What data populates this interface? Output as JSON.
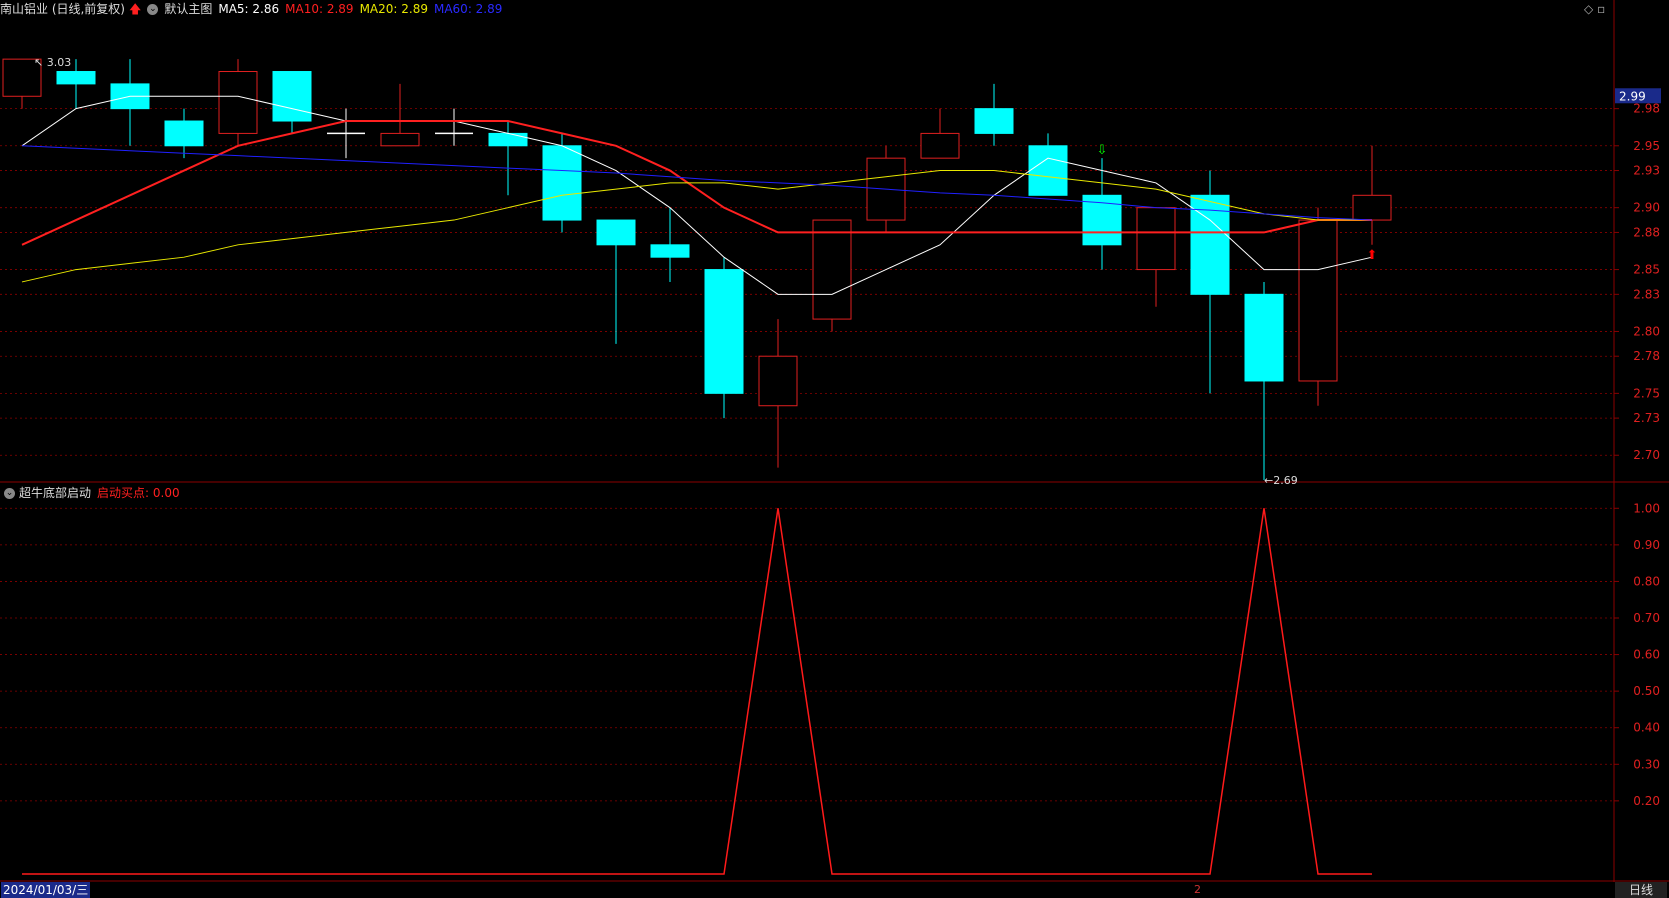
{
  "header": {
    "stock_name": "南山铝业 (日线,前复权)",
    "main_chart_label": "默认主图",
    "ma5": "MA5: 2.86",
    "ma10": "MA10: 2.89",
    "ma20": "MA20: 2.89",
    "ma60": "MA60: 2.89"
  },
  "sub_header": {
    "indicator_name": "超牛底部启动",
    "signal_label": "启动买点: 0.00"
  },
  "footer": {
    "date": "2024/01/03/三",
    "period": "日线",
    "mid_marker": "2"
  },
  "colors": {
    "background": "#000000",
    "up": "#e02020",
    "down": "#00ffff",
    "ma5": "#ffffff",
    "ma10": "#ff2020",
    "ma20": "#e8e800",
    "ma60": "#2020ff",
    "axis": "#8b0000",
    "indicator": "#ff1a1a"
  },
  "chart_data": [
    {
      "type": "candlestick",
      "title": "南山铝业 (日线,前复权)",
      "ylim": [
        2.68,
        3.05
      ],
      "y_ticks": [
        2.7,
        2.73,
        2.75,
        2.78,
        2.8,
        2.83,
        2.85,
        2.88,
        2.9,
        2.93,
        2.95,
        2.98
      ],
      "current_price_tag": "2.99",
      "annotations": {
        "high": "3.03",
        "low": "2.69"
      },
      "candles": [
        {
          "o": 2.99,
          "h": 3.02,
          "l": 2.98,
          "c": 3.02
        },
        {
          "o": 3.01,
          "h": 3.02,
          "l": 2.98,
          "c": 3.0
        },
        {
          "o": 3.0,
          "h": 3.02,
          "l": 2.95,
          "c": 2.98
        },
        {
          "o": 2.97,
          "h": 2.98,
          "l": 2.94,
          "c": 2.95
        },
        {
          "o": 2.96,
          "h": 3.02,
          "l": 2.95,
          "c": 3.01
        },
        {
          "o": 3.01,
          "h": 3.01,
          "l": 2.96,
          "c": 2.97
        },
        {
          "o": 2.96,
          "h": 2.98,
          "l": 2.94,
          "c": 2.96
        },
        {
          "o": 2.95,
          "h": 3.0,
          "l": 2.95,
          "c": 2.96
        },
        {
          "o": 2.96,
          "h": 2.98,
          "l": 2.95,
          "c": 2.96
        },
        {
          "o": 2.96,
          "h": 2.97,
          "l": 2.91,
          "c": 2.95
        },
        {
          "o": 2.95,
          "h": 2.96,
          "l": 2.88,
          "c": 2.89
        },
        {
          "o": 2.89,
          "h": 2.89,
          "l": 2.79,
          "c": 2.87
        },
        {
          "o": 2.87,
          "h": 2.9,
          "l": 2.84,
          "c": 2.86
        },
        {
          "o": 2.85,
          "h": 2.86,
          "l": 2.73,
          "c": 2.75
        },
        {
          "o": 2.74,
          "h": 2.81,
          "l": 2.69,
          "c": 2.78
        },
        {
          "o": 2.81,
          "h": 2.89,
          "l": 2.8,
          "c": 2.89
        },
        {
          "o": 2.89,
          "h": 2.95,
          "l": 2.88,
          "c": 2.94
        },
        {
          "o": 2.94,
          "h": 2.98,
          "l": 2.94,
          "c": 2.96
        },
        {
          "o": 2.98,
          "h": 3.0,
          "l": 2.95,
          "c": 2.96
        },
        {
          "o": 2.95,
          "h": 2.96,
          "l": 2.91,
          "c": 2.91
        },
        {
          "o": 2.91,
          "h": 2.94,
          "l": 2.85,
          "c": 2.87
        },
        {
          "o": 2.85,
          "h": 2.9,
          "l": 2.82,
          "c": 2.9
        },
        {
          "o": 2.91,
          "h": 2.93,
          "l": 2.75,
          "c": 2.83
        },
        {
          "o": 2.83,
          "h": 2.84,
          "l": 2.68,
          "c": 2.76
        },
        {
          "o": 2.76,
          "h": 2.9,
          "l": 2.74,
          "c": 2.89
        },
        {
          "o": 2.89,
          "h": 2.95,
          "l": 2.87,
          "c": 2.91
        }
      ],
      "series": [
        {
          "name": "MA5",
          "values": [
            2.95,
            2.98,
            2.99,
            2.99,
            2.99,
            2.98,
            2.97,
            2.97,
            2.97,
            2.96,
            2.95,
            2.93,
            2.9,
            2.86,
            2.83,
            2.83,
            2.85,
            2.87,
            2.91,
            2.94,
            2.93,
            2.92,
            2.89,
            2.85,
            2.85,
            2.86
          ]
        },
        {
          "name": "MA10",
          "values": [
            2.87,
            2.89,
            2.91,
            2.93,
            2.95,
            2.96,
            2.97,
            2.97,
            2.97,
            2.97,
            2.96,
            2.95,
            2.93,
            2.9,
            2.88,
            2.88,
            2.88,
            2.88,
            2.88,
            2.88,
            2.88,
            2.88,
            2.88,
            2.88,
            2.89,
            2.89
          ]
        },
        {
          "name": "MA20",
          "values": [
            2.84,
            2.85,
            2.855,
            2.86,
            2.87,
            2.875,
            2.88,
            2.885,
            2.89,
            2.9,
            2.91,
            2.915,
            2.92,
            2.92,
            2.915,
            2.92,
            2.925,
            2.93,
            2.93,
            2.925,
            2.92,
            2.915,
            2.905,
            2.895,
            2.89,
            2.89
          ]
        },
        {
          "name": "MA60",
          "values": [
            2.95,
            2.948,
            2.946,
            2.944,
            2.942,
            2.94,
            2.938,
            2.936,
            2.934,
            2.932,
            2.93,
            2.928,
            2.925,
            2.922,
            2.92,
            2.918,
            2.915,
            2.912,
            2.91,
            2.907,
            2.904,
            2.9,
            2.898,
            2.895,
            2.892,
            2.89
          ]
        }
      ],
      "signal_arrows": [
        {
          "index": 20,
          "direction": "down",
          "color": "#00ff00"
        },
        {
          "index": 25,
          "direction": "up",
          "color": "#ff0000"
        }
      ]
    },
    {
      "type": "line",
      "title": "超牛底部启动",
      "ylim": [
        0,
        1.05
      ],
      "y_ticks": [
        0.2,
        0.3,
        0.4,
        0.5,
        0.6,
        0.7,
        0.8,
        0.9,
        1.0
      ],
      "series": [
        {
          "name": "启动买点",
          "values": [
            0,
            0,
            0,
            0,
            0,
            0,
            0,
            0,
            0,
            0,
            0,
            0,
            0,
            0,
            1,
            0,
            0,
            0,
            0,
            0,
            0,
            0,
            0,
            1,
            0,
            0
          ]
        }
      ]
    }
  ]
}
